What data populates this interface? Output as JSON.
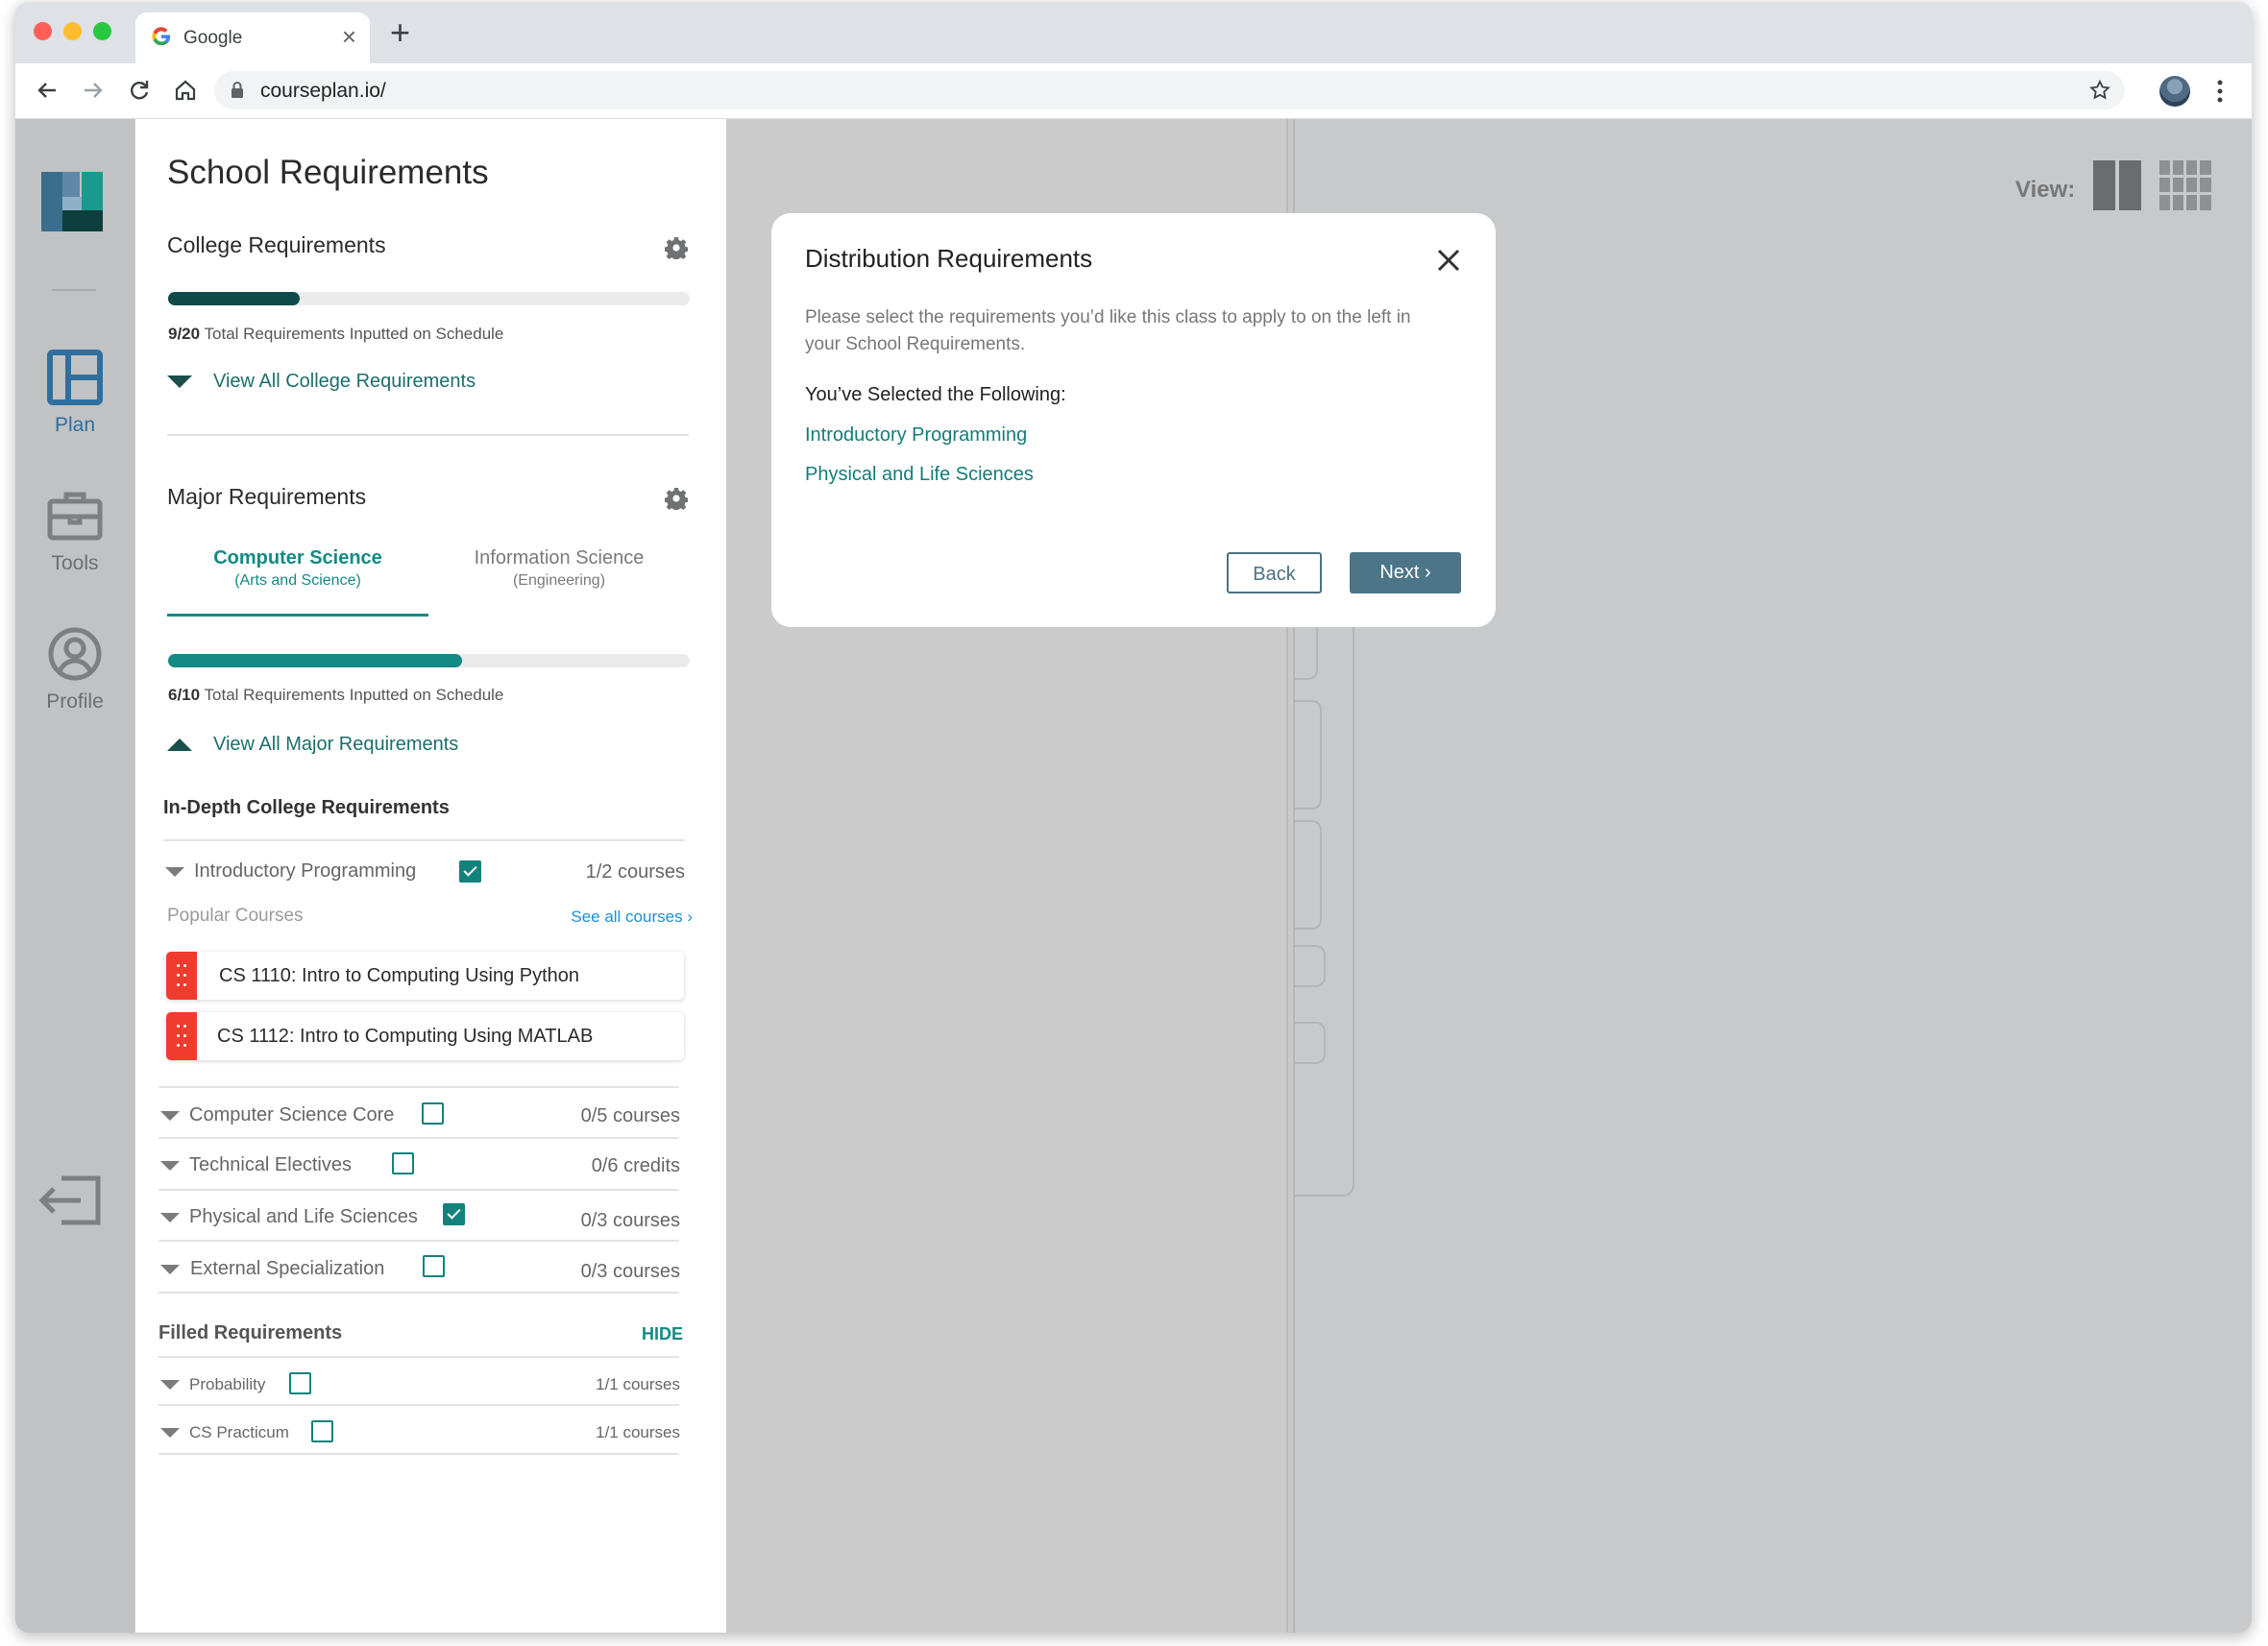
{
  "browser": {
    "tab_title": "Google",
    "url": "courseplan.io/"
  },
  "nav": {
    "items": [
      {
        "label": "Plan",
        "icon": "plan-icon"
      },
      {
        "label": "Tools",
        "icon": "toolbox-icon"
      },
      {
        "label": "Profile",
        "icon": "profile-icon"
      }
    ],
    "logout_icon": "logout-icon"
  },
  "panel": {
    "title": "School Requirements",
    "college": {
      "heading": "College Requirements",
      "progress_value": 9,
      "progress_total": 20,
      "progress_count": "9/20",
      "progress_text": "Total Requirements Inputted on Schedule",
      "view_all": "View All College Requirements"
    },
    "major": {
      "heading": "Major Requirements",
      "tabs": [
        {
          "name": "Computer Science",
          "sub": "(Arts and Science)",
          "active": true
        },
        {
          "name": "Information Science",
          "sub": "(Engineering)",
          "active": false
        }
      ],
      "progress_value": 6,
      "progress_total": 10,
      "progress_count": "6/10",
      "progress_text": "Total Requirements Inputted on Schedule",
      "view_all": "View All Major Requirements"
    },
    "in_depth": {
      "heading": "In-Depth College Requirements",
      "first": {
        "name": "Introductory Programming",
        "checked": true,
        "count": "1/2 courses"
      },
      "popular_label": "Popular Courses",
      "see_all": "See all courses",
      "courses": [
        "CS 1110: Intro to Computing Using Python",
        "CS 1112: Intro to Computing Using MATLAB"
      ],
      "rows": [
        {
          "name": "Computer Science Core",
          "checked": false,
          "count": "0/5 courses"
        },
        {
          "name": "Technical Electives",
          "checked": false,
          "count": "0/6 credits"
        },
        {
          "name": "Physical and Life Sciences",
          "checked": true,
          "count": "0/3 courses"
        },
        {
          "name": "External Specialization",
          "checked": false,
          "count": "0/3 courses"
        }
      ]
    },
    "filled": {
      "heading": "Filled Requirements",
      "hide": "HIDE",
      "rows": [
        {
          "name": "Probability",
          "checked": false,
          "count": "1/1 courses"
        },
        {
          "name": "CS Practicum",
          "checked": false,
          "count": "1/1 courses"
        }
      ]
    }
  },
  "view": {
    "label": "View:"
  },
  "modal": {
    "title": "Distribution Requirements",
    "description": "Please select the requirements you’d like this class to apply to on the left in your School Requirements.",
    "selected_heading": "You’ve Selected the Following:",
    "selected": [
      "Introductory Programming",
      "Physical and Life Sciences"
    ],
    "back": "Back",
    "next": "Next ›"
  },
  "colors": {
    "accent": "#138a84",
    "college_bar": "#0f4b4a",
    "grip": "#f03c2e",
    "button": "#4c7588"
  }
}
